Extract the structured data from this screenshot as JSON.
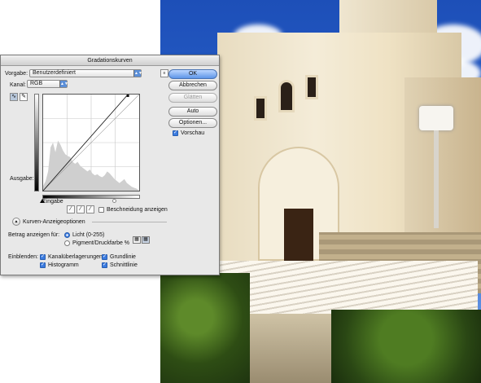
{
  "dialog": {
    "title": "Gradationskurven",
    "preset_label": "Vorgabe:",
    "preset_value": "Benutzerdefiniert",
    "preset_menu_icon": "list-menu-icon",
    "channel_label": "Kanal:",
    "channel_value": "RGB",
    "output_label": "Ausgabe:",
    "input_label": "Eingabe",
    "show_clipping_label": "Beschneidung anzeigen",
    "show_clipping_checked": false,
    "display_options_label": "Kurven-Anzeigeoptionen",
    "show_amount_label": "Betrag anzeigen für:",
    "light_label": "Licht (0-255)",
    "light_selected": true,
    "pigment_label": "Pigment/Druckfarbe %",
    "show_label": "Einblenden:",
    "channel_overlays_label": "Kanalüberlagerungen",
    "baseline_label": "Grundlinie",
    "histogram_label": "Histogramm",
    "intersection_label": "Schnittlinie",
    "channel_overlays_checked": true,
    "baseline_checked": true,
    "histogram_checked": true,
    "intersection_checked": true
  },
  "buttons": {
    "ok": "OK",
    "cancel": "Abbrechen",
    "smooth": "Glätten",
    "auto": "Auto",
    "options": "Optionen..."
  },
  "preview": {
    "label": "Vorschau",
    "checked": true
  },
  "tools": {
    "curve_tool_icon": "curve-point-icon",
    "pencil_tool_icon": "pencil-icon",
    "black_eyedropper_icon": "eyedropper-black-icon",
    "gray_eyedropper_icon": "eyedropper-gray-icon",
    "white_eyedropper_icon": "eyedropper-white-icon"
  },
  "curve": {
    "input_shadow": 0,
    "input_highlight": 225,
    "output_at_highlight": 255,
    "histogram_levels": [
      0.05,
      0.1,
      0.2,
      0.45,
      0.5,
      0.4,
      0.52,
      0.48,
      0.42,
      0.38,
      0.36,
      0.35,
      0.3,
      0.28,
      0.3,
      0.26,
      0.24,
      0.22,
      0.2,
      0.22,
      0.18,
      0.16,
      0.17,
      0.15,
      0.14,
      0.16,
      0.2,
      0.18,
      0.15,
      0.12,
      0.1,
      0.08,
      0.1,
      0.12,
      0.08,
      0.06,
      0.04,
      0.03,
      0.02,
      0.0
    ]
  },
  "colors": {
    "accent": "#3b7be0",
    "dialog_bg": "#e8e8e8"
  }
}
